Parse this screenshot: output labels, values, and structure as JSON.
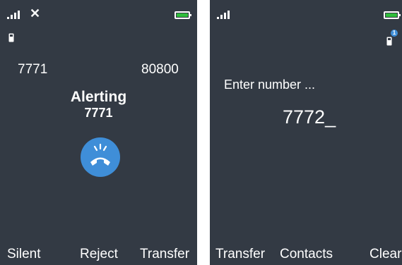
{
  "left_screen": {
    "status_x": "✕",
    "left_number": "7771",
    "right_number": "80800",
    "call_state": "Alerting",
    "caller_number": "7771",
    "softkeys": [
      "Silent",
      "Reject",
      "Transfer"
    ]
  },
  "right_screen": {
    "prompt": "Enter number ...",
    "entered_number": "7772",
    "cursor": "_",
    "notification_count": "1",
    "softkeys": [
      "Transfer",
      "Contacts",
      "Clear"
    ]
  },
  "colors": {
    "screen_bg": "#333a44",
    "battery": "#2ebd3a",
    "call_button": "#3f8ed8"
  },
  "icons": [
    "signal-icon",
    "no-signal-x-icon",
    "battery-icon",
    "handset-icon",
    "ringing-handset-icon",
    "notification-badge"
  ]
}
